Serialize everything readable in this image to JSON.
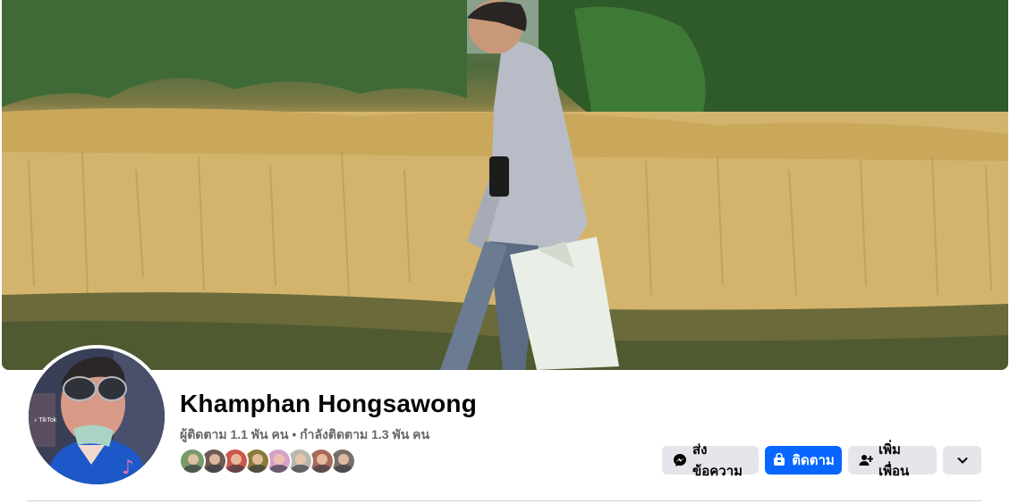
{
  "profile": {
    "name": "Khamphan Hongsawong",
    "stats": "ผู้ติดตาม 1.1 พัน คน • กำลังติดตาม 1.3 พัน คน"
  },
  "friends": [
    {
      "color": "#7a9a6a"
    },
    {
      "color": "#6b5a55"
    },
    {
      "color": "#c9584a"
    },
    {
      "color": "#8a7a3a"
    },
    {
      "color": "#d6a2c8"
    },
    {
      "color": "#b8b8b0"
    },
    {
      "color": "#a86a5a"
    },
    {
      "color": "#7a6e6a"
    }
  ],
  "actions": {
    "message_label": "ส่งข้อความ",
    "follow_label": "ติดตาม",
    "add_friend_label": "เพิ่มเพื่อน"
  },
  "icons": {
    "message": "messenger-icon",
    "follow": "follow-icon",
    "add_friend": "add-friend-icon",
    "more": "chevron-down-icon"
  },
  "colors": {
    "accent": "#0866ff",
    "secondary_button": "#e4e6eb",
    "muted_text": "#65676b"
  }
}
